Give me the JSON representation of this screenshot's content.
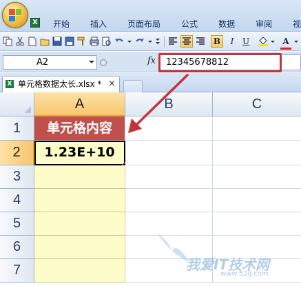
{
  "ribbon": {
    "tabs": [
      {
        "label": "开始"
      },
      {
        "label": "插入"
      },
      {
        "label": "页面布局"
      },
      {
        "label": "公式"
      },
      {
        "label": "数据"
      },
      {
        "label": "审阅"
      },
      {
        "label": "视"
      }
    ]
  },
  "toolbar": {
    "bold_label": "B",
    "italic_label": "I",
    "underline_label": "U",
    "font_color_label": "A"
  },
  "formula_bar": {
    "name_box": "A2",
    "fx_label": "fx",
    "formula": "12345678812"
  },
  "workbook": {
    "tab_title": "单元格数据太长.xlsx *",
    "close_label": "×"
  },
  "grid": {
    "columns": [
      "A",
      "B",
      "C"
    ],
    "rows": [
      "1",
      "2",
      "3",
      "4",
      "5",
      "6",
      "7"
    ],
    "selected_column": "A",
    "selected_row": "2",
    "cells": {
      "A1": "单元格内容",
      "A2": "1.23E+10"
    }
  },
  "colors": {
    "header_fill": "#c0504d",
    "data_fill": "#fefcc8",
    "annotation_red": "#c0343a"
  },
  "watermark": {
    "text": "我爱IT技术网",
    "url": "www.52ij.com"
  }
}
